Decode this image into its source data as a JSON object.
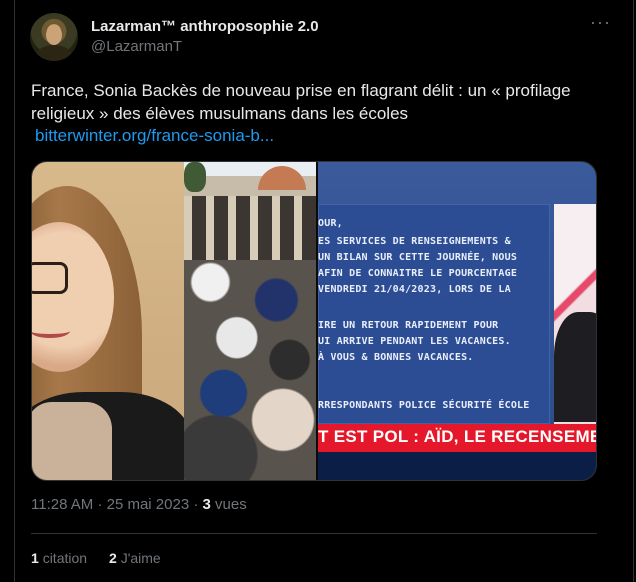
{
  "author": {
    "name": "Lazarman™ anthroposophie 2.0",
    "handle": "@LazarmanT"
  },
  "more_icon": "···",
  "tweet": {
    "text": "France, Sonia Backès de nouveau prise en flagrant délit : un « profilage religieux » des élèves musulmans dans les écoles",
    "link": "bitterwinter.org/france-sonia-b..."
  },
  "media": {
    "doc_lines": [
      "OUR,",
      "ES SERVICES DE RENSEIGNEMENTS &",
      "UN BILAN SUR CETTE JOURNÉE, NOUS",
      "  AFIN DE CONNAITRE LE POURCENTAGE",
      "VENDREDI 21/04/2023, LORS DE LA",
      "IRE UN RETOUR RAPIDEMENT POUR",
      "UI ARRIVE PENDANT LES VACANCES.",
      "À VOUS & BONNES VACANCES.",
      "RRESPONDANTS POLICE SÉCURITÉ ÉCOLE"
    ],
    "banner": "T EST POL : AÏD, LE RECENSEMENT POLI"
  },
  "meta": {
    "time": "11:28 AM",
    "date": "25 mai 2023",
    "views_count": "3",
    "views_label": "vues"
  },
  "stats": {
    "quotes_count": "1",
    "quotes_label": "citation",
    "likes_count": "2",
    "likes_label": "J'aime"
  },
  "colors": {
    "accent": "#1d9bf0",
    "muted": "#71767b",
    "background": "#000000",
    "banner_red": "#e5182b"
  }
}
